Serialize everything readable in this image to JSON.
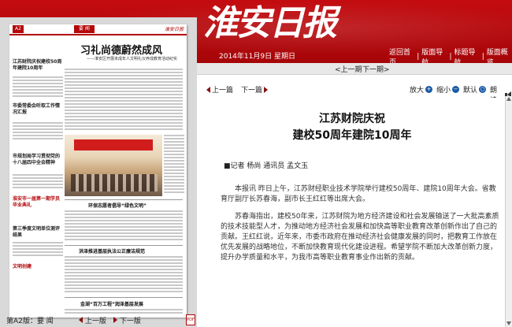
{
  "header": {
    "masthead": "淮安日报",
    "date": "2014年11月9日 星期日",
    "nav": [
      "返回首页",
      "版面导航",
      "标题导航",
      "版面概览"
    ]
  },
  "issue_nav": {
    "prev": "上一期",
    "next": "下一期"
  },
  "paper": {
    "page_no": "A2",
    "section": "要 闻",
    "brand": "淮安日报",
    "headline": "习礼尚德蔚然成风",
    "subhead": "——淮安区开展未成年人文明礼仪养成教育活动纪实",
    "briefs": [
      "江苏财院庆祝建校50周年建院10周年",
      "市委常委会听取工作情况汇报",
      "市规划局学习贯彻党的十八届四中全会精神",
      "淮安市一届第一期学员毕业典礼",
      "第三季度文明单位测评结果",
      "文明创建"
    ],
    "titles": [
      "环保志愿者倡导“绿色文明”",
      "洪泽推进基层执法公正廉洁规范",
      "金湖“百万工程”润泽基层发展"
    ]
  },
  "pager": {
    "label": "第A2版：要 闻",
    "prev": "上一版",
    "next": "下一版",
    "pdf": "PDF"
  },
  "toolbar": {
    "prev": "上一篇",
    "next": "下一篇",
    "zoom_in": "放大",
    "zoom_out": "缩小",
    "default": "默认",
    "read": "朗读"
  },
  "article": {
    "title1": "江苏财院庆祝",
    "title2": "建校50周年建院10周年",
    "byline": "■记者 杨尚 通讯员 孟文玉",
    "para1": "本报讯 昨日上午，江苏财经职业技术学院举行建校50周年、建院10周年大会。省教育厅副厅长苏春海，副市长王红红等出席大会。",
    "para2": "苏春海指出，建校50年来，江苏财院为地方经济建设和社会发展输送了一大批高素质的技术技能型人才，为推动地方经济社会发展和加快高等职业教育改革创新作出了自己的贡献。王红红说，近年来，市委市政府在推动经济社会健康发展的同时，把教育工作放在优先发展的战略地位，不断加快教育现代化建设进程。希望学院不断加大改革创新力度，提升办学质量和水平，为我市高等职业教育事业作出新的贡献。"
  },
  "colors": {
    "brand_red": "#b3070a",
    "icon_blue": "#1a5aa6"
  }
}
